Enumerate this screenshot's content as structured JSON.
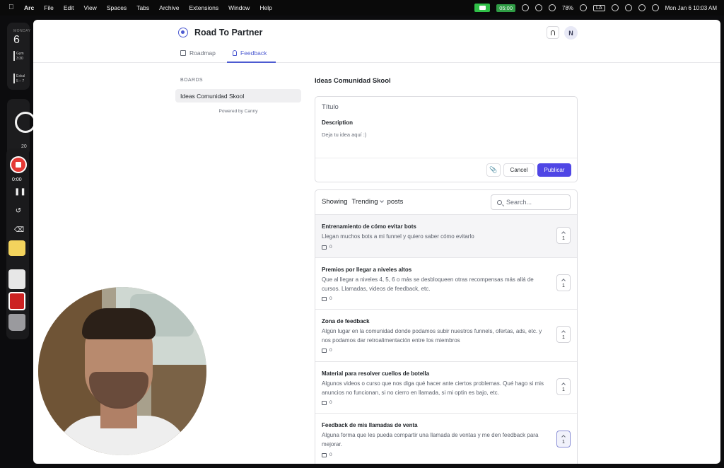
{
  "menubar": {
    "app": "Arc",
    "items": [
      "File",
      "Edit",
      "View",
      "Spaces",
      "Tabs",
      "Archive",
      "Extensions",
      "Window",
      "Help"
    ],
    "recording_timer": "05:00",
    "battery": "78%",
    "input_lang": "LA",
    "datetime": "Mon Jan 6  10:03 AM"
  },
  "desktop": {
    "calendar_month": "MONDAY",
    "calendar_day": "6",
    "event1_title": "Gym",
    "event1_time": "3:30",
    "event2_title": "Eskal",
    "event2_time": "5 – 7",
    "clock_label": "20",
    "rec_time": "0:00"
  },
  "header": {
    "title": "Road To Partner",
    "avatar_initial": "N"
  },
  "tabs": {
    "roadmap": "Roadmap",
    "feedback": "Feedback"
  },
  "sidebar": {
    "heading": "BOARDS",
    "board": "Ideas Comunidad Skool",
    "powered_by": "Powered by Canny"
  },
  "board_title": "Ideas Comunidad Skool",
  "composer": {
    "title_placeholder": "Título",
    "description_label": "Description",
    "description_placeholder": "Deja tu idea aquí :)",
    "cancel": "Cancel",
    "publish": "Publicar"
  },
  "posts_header": {
    "showing": "Showing",
    "sort": "Trending",
    "posts": "posts",
    "search_placeholder": "Search..."
  },
  "posts": [
    {
      "title": "Entrenamiento de cómo evitar bots",
      "body": "Llegan muchos bots a mi funnel y quiero saber cómo evitarlo",
      "comments": "0",
      "votes": "1"
    },
    {
      "title": "Premios por llegar a niveles altos",
      "body": "Que al llegar a niveles 4, 5, 6 o más se desbloqueen otras recompensas más allá de cursos. Llamadas, videos de feedback, etc.",
      "comments": "0",
      "votes": "1"
    },
    {
      "title": "Zona de feedback",
      "body": "Algún lugar en la comunidad donde podamos subir nuestros funnels, ofertas, ads, etc. y nos podamos dar retroalimentación entre los miembros",
      "comments": "0",
      "votes": "1"
    },
    {
      "title": "Material para resolver cuellos de botella",
      "body": "Algunos videos o curso que nos diga qué hacer ante ciertos problemas. Qué hago si mis anuncios no funcionan, si no cierro en llamada, si mi optin es bajo, etc.",
      "comments": "0",
      "votes": "1"
    },
    {
      "title": "Feedback de mis llamadas de venta",
      "body": "Alguna forma que les pueda compartir una llamada de ventas y me den feedback para mejorar.",
      "comments": "0",
      "votes": "1"
    }
  ],
  "colors": {
    "accent": "#4f46e5",
    "tab_active": "#4d5bd1",
    "record": "#e53935"
  }
}
